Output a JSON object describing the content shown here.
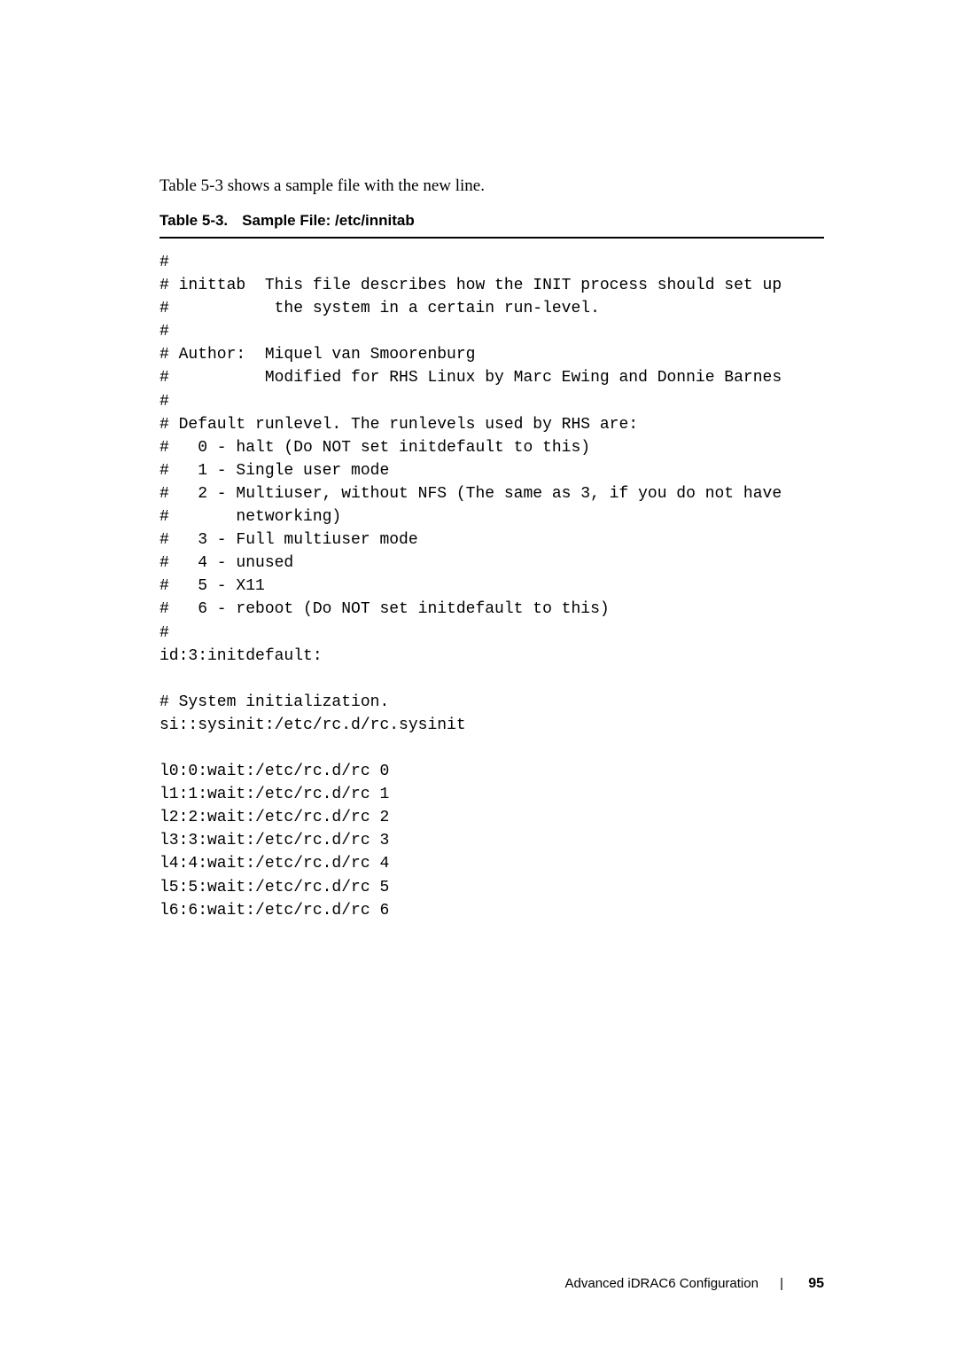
{
  "intro": "Table 5-3 shows a sample file with the new line.",
  "table": {
    "num": "Table 5-3.",
    "caption": "Sample File: /etc/innitab"
  },
  "code": "#\n# inittab  This file describes how the INIT process should set up\n#           the system in a certain run-level.\n#\n# Author:  Miquel van Smoorenburg \n#          Modified for RHS Linux by Marc Ewing and Donnie Barnes\n#\n# Default runlevel. The runlevels used by RHS are:\n#   0 - halt (Do NOT set initdefault to this)\n#   1 - Single user mode\n#   2 - Multiuser, without NFS (The same as 3, if you do not have\n#       networking)\n#   3 - Full multiuser mode\n#   4 - unused\n#   5 - X11\n#   6 - reboot (Do NOT set initdefault to this)\n#\nid:3:initdefault:\n\n# System initialization.\nsi::sysinit:/etc/rc.d/rc.sysinit\n\nl0:0:wait:/etc/rc.d/rc 0\nl1:1:wait:/etc/rc.d/rc 1\nl2:2:wait:/etc/rc.d/rc 2\nl3:3:wait:/etc/rc.d/rc 3\nl4:4:wait:/etc/rc.d/rc 4\nl5:5:wait:/etc/rc.d/rc 5\nl6:6:wait:/etc/rc.d/rc 6",
  "footer": {
    "section": "Advanced iDRAC6 Configuration",
    "page": "95"
  }
}
